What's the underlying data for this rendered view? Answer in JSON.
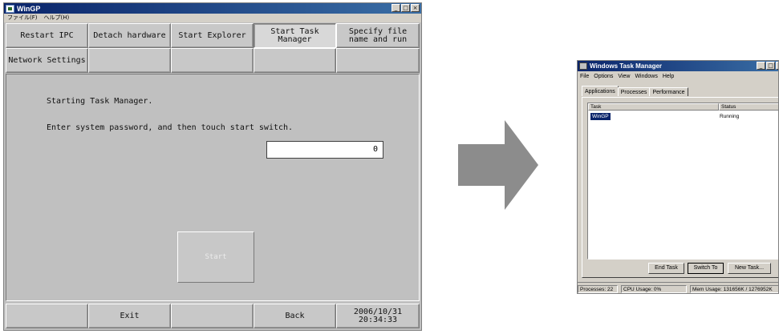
{
  "wingp": {
    "title": "WinGP",
    "menu": [
      "ファイル(F)",
      "ヘルプ(H)"
    ],
    "row1": [
      "Restart IPC",
      "Detach hardware",
      "Start Explorer",
      "Start Task Manager",
      "Specify file name and run"
    ],
    "row2": [
      "Network Settings",
      "",
      "",
      "",
      ""
    ],
    "message1": "Starting Task Manager.",
    "message2": "Enter system password, and then touch start switch.",
    "password_value": "0",
    "start_label": "Start",
    "bottom": [
      "",
      "Exit",
      "",
      "Back",
      ""
    ],
    "date": "2006/10/31",
    "time": "20:34:33",
    "window_buttons": [
      "_",
      "□",
      "×"
    ]
  },
  "task_manager": {
    "title": "Windows Task Manager",
    "menu": [
      "File",
      "Options",
      "View",
      "Windows",
      "Help"
    ],
    "tabs": [
      "Applications",
      "Processes",
      "Performance"
    ],
    "columns": [
      "Task",
      "Status"
    ],
    "rows": [
      {
        "task": "WinGP",
        "status": "Running"
      }
    ],
    "buttons": [
      "End Task",
      "Switch To",
      "New Task..."
    ],
    "status_processes": "Processes: 22",
    "status_cpu": "CPU Usage: 0%",
    "status_mem": "Mem Usage: 131656K / 1276952K"
  },
  "colors": {
    "titlebar": "#0a246a",
    "arrow": "#8c8c8c",
    "selection": "#0a246a"
  }
}
